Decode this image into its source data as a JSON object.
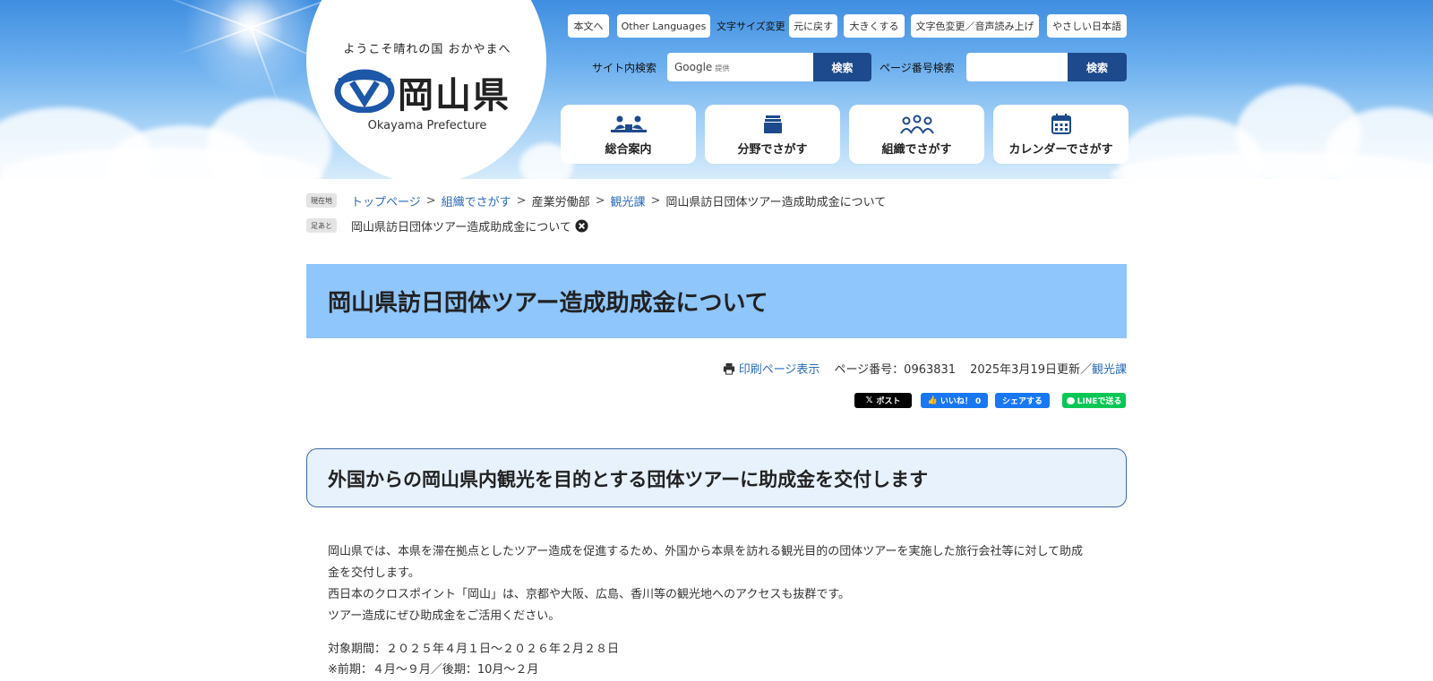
{
  "header": {
    "tagline": "ようこそ晴れの国 おかやまへ",
    "logo_name": "岡山県",
    "logo_en": "Okayama Prefecture",
    "top_links": {
      "main_text": "本文へ",
      "other_languages": "Other Languages",
      "font_size_label": "文字サイズ変更",
      "reset": "元に戻す",
      "enlarge": "大きくする",
      "color_voice": "文字色変更／音声読み上げ",
      "easy_japanese": "やさしい日本語"
    },
    "site_search": {
      "label": "サイト内検索",
      "google": "Google",
      "provided": "提供",
      "button": "検索"
    },
    "page_number_search": {
      "label": "ページ番号検索",
      "button": "検索"
    },
    "nav": [
      {
        "label": "総合案内",
        "icon": "people-desk-icon"
      },
      {
        "label": "分野でさがす",
        "icon": "stack-icon"
      },
      {
        "label": "組織でさがす",
        "icon": "group-icon"
      },
      {
        "label": "カレンダーでさがす",
        "icon": "calendar-icon"
      }
    ]
  },
  "breadcrumb": {
    "current_tag": "現在地",
    "items": [
      "トップページ",
      "組織でさがす",
      "産業労働部",
      "観光課",
      "岡山県訪日団体ツアー造成助成金について"
    ],
    "separator": ">",
    "footprint_tag": "足あと",
    "footprint_item": "岡山県訪日団体ツアー造成助成金について"
  },
  "page": {
    "title": "岡山県訪日団体ツアー造成助成金について",
    "print_label": "印刷ページ表示",
    "page_number": "ページ番号：0963831",
    "updated": "2025年3月19日更新／",
    "department": "観光課"
  },
  "share": {
    "x_post": "ポスト",
    "fb_like": "いいね！ 0",
    "fb_share": "シェアする",
    "line": "LINEで送る",
    "colors": {
      "x": "#000000",
      "facebook": "#1877f2",
      "line": "#06c755"
    }
  },
  "content": {
    "subheading": "外国からの岡山県内観光を目的とする団体ツアーに助成金を交付します",
    "para1_line1": "岡山県では、本県を滞在拠点としたツアー造成を促進するため、外国から本県を訪れる観光目的の団体ツアーを実施した旅行会社等に対して助成",
    "para1_line2": "金を交付します。",
    "para1_line3": "西日本のクロスポイント「岡山」は、京都や大阪、広島、香川等の観光地へのアクセスも抜群です。",
    "para1_line4": "ツアー造成にぜひ助成金をご活用ください。",
    "period": "対象期間：２０２５年４月１日～２０２６年２月２８日",
    "period_note": "※前期：４月～９月／後期：10月～２月"
  },
  "colors": {
    "title_bg": "#8fc6fb",
    "subhead_bg": "#e7f2fd",
    "search_button": "#1c4a8c",
    "link": "#2a6bb8",
    "logo_blue": "#1c57a8"
  }
}
